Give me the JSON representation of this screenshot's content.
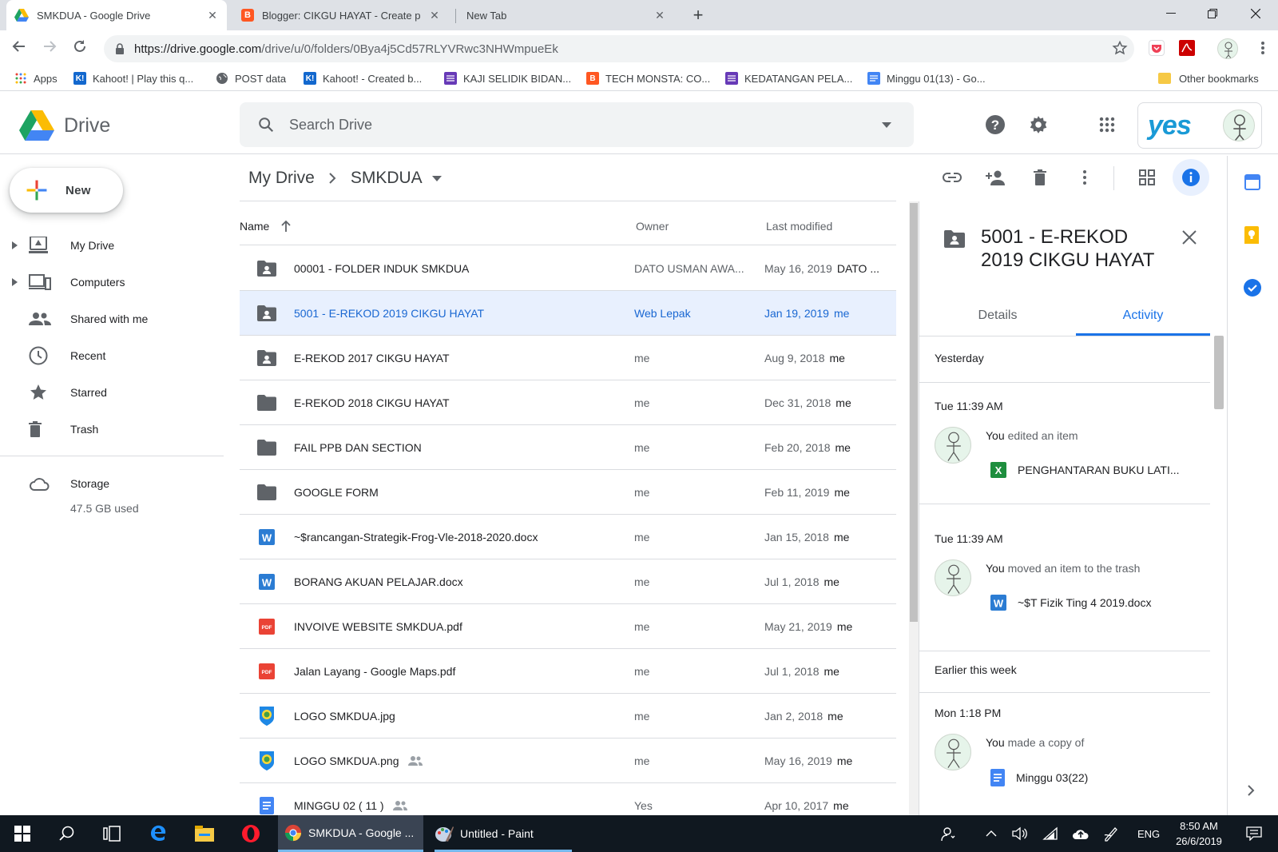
{
  "browser": {
    "tabs": [
      {
        "title": "SMKDUA - Google Drive",
        "active": true,
        "icon": "drive-icon"
      },
      {
        "title": "Blogger: CIKGU HAYAT - Create p",
        "active": false,
        "icon": "blogger-icon"
      },
      {
        "title": "New Tab",
        "active": false,
        "icon": ""
      }
    ],
    "url_host": "https://drive.google.com",
    "url_path": "/drive/u/0/folders/0Bya4j5Cd57RLYVRwc3NHWmpueEk",
    "bookmarks": [
      {
        "label": "Apps",
        "icon": "apps-grid-icon",
        "color": "#ea4335"
      },
      {
        "label": "Kahoot! | Play this q...",
        "icon": "kahoot-icon",
        "color": "#46178f"
      },
      {
        "label": "POST data",
        "icon": "globe-icon",
        "color": "#5f6368"
      },
      {
        "label": "Kahoot! - Created b...",
        "icon": "kahoot-icon",
        "color": "#46178f"
      },
      {
        "label": "KAJI SELIDIK BIDAN...",
        "icon": "forms-icon",
        "color": "#673ab7"
      },
      {
        "label": "TECH MONSTA: CO...",
        "icon": "blogger-icon",
        "color": "#ff5722"
      },
      {
        "label": "KEDATANGAN PELA...",
        "icon": "forms-icon",
        "color": "#673ab7"
      },
      {
        "label": "Minggu 01(13) - Go...",
        "icon": "docs-icon",
        "color": "#4285f4"
      }
    ],
    "other_bookmarks": "Other bookmarks"
  },
  "drive": {
    "logo_text": "Drive",
    "search_placeholder": "Search Drive",
    "account_badge": "yes",
    "new_label": "New",
    "nav": [
      {
        "label": "My Drive",
        "icon": "my-drive-icon",
        "expandable": true
      },
      {
        "label": "Computers",
        "icon": "computers-icon",
        "expandable": true
      },
      {
        "label": "Shared with me",
        "icon": "shared-icon",
        "expandable": false
      },
      {
        "label": "Recent",
        "icon": "clock-icon",
        "expandable": false
      },
      {
        "label": "Starred",
        "icon": "star-icon",
        "expandable": false
      },
      {
        "label": "Trash",
        "icon": "trash-icon",
        "expandable": false
      }
    ],
    "storage_label": "Storage",
    "storage_used": "47.5 GB used",
    "breadcrumb": {
      "root": "My Drive",
      "current": "SMKDUA"
    },
    "columns": {
      "name": "Name",
      "owner": "Owner",
      "modified": "Last modified"
    },
    "files": [
      {
        "name": "00001 - FOLDER INDUK SMKDUA",
        "type": "shared-folder",
        "owner": "DATO USMAN AWA...",
        "modified": "May 16, 2019",
        "by": "DATO ...",
        "shared": false,
        "selected": false
      },
      {
        "name": "5001 - E-REKOD 2019 CIKGU HAYAT",
        "type": "shared-folder",
        "owner": "Web Lepak",
        "modified": "Jan 19, 2019",
        "by": "me",
        "shared": false,
        "selected": true
      },
      {
        "name": "E-REKOD 2017 CIKGU HAYAT",
        "type": "shared-folder",
        "owner": "me",
        "modified": "Aug 9, 2018",
        "by": "me",
        "shared": false,
        "selected": false
      },
      {
        "name": "E-REKOD 2018 CIKGU HAYAT",
        "type": "folder",
        "owner": "me",
        "modified": "Dec 31, 2018",
        "by": "me",
        "shared": false,
        "selected": false
      },
      {
        "name": "FAIL PPB DAN SECTION",
        "type": "folder",
        "owner": "me",
        "modified": "Feb 20, 2018",
        "by": "me",
        "shared": false,
        "selected": false
      },
      {
        "name": "GOOGLE FORM",
        "type": "folder",
        "owner": "me",
        "modified": "Feb 11, 2019",
        "by": "me",
        "shared": false,
        "selected": false
      },
      {
        "name": "~$rancangan-Strategik-Frog-Vle-2018-2020.docx",
        "type": "word",
        "owner": "me",
        "modified": "Jan 15, 2018",
        "by": "me",
        "shared": false,
        "selected": false
      },
      {
        "name": "BORANG AKUAN PELAJAR.docx",
        "type": "word",
        "owner": "me",
        "modified": "Jul 1, 2018",
        "by": "me",
        "shared": false,
        "selected": false
      },
      {
        "name": "INVOIVE WEBSITE SMKDUA.pdf",
        "type": "pdf",
        "owner": "me",
        "modified": "May 21, 2019",
        "by": "me",
        "shared": false,
        "selected": false
      },
      {
        "name": "Jalan Layang - Google Maps.pdf",
        "type": "pdf",
        "owner": "me",
        "modified": "Jul 1, 2018",
        "by": "me",
        "shared": false,
        "selected": false
      },
      {
        "name": "LOGO SMKDUA.jpg",
        "type": "image",
        "owner": "me",
        "modified": "Jan 2, 2018",
        "by": "me",
        "shared": false,
        "selected": false
      },
      {
        "name": "LOGO SMKDUA.png",
        "type": "image",
        "owner": "me",
        "modified": "May 16, 2019",
        "by": "me",
        "shared": true,
        "selected": false
      },
      {
        "name": "MINGGU 02 ( 11 )",
        "type": "doc",
        "owner": "Yes",
        "modified": "Apr 10, 2017",
        "by": "me",
        "shared": true,
        "selected": false
      }
    ],
    "details": {
      "title_line1": "5001 - E-REKOD",
      "title_line2": "2019 CIKGU HAYAT",
      "tab_details": "Details",
      "tab_activity": "Activity",
      "groups": [
        {
          "heading": "Yesterday",
          "items": [
            {
              "time": "Tue 11:39 AM",
              "actor": "You",
              "action": "edited an item",
              "file": "PENGHANTARAN BUKU LATI...",
              "file_icon": "sheets-icon"
            },
            {
              "time": "Tue 11:39 AM",
              "actor": "You",
              "action": "moved an item to the trash",
              "file": "~$T Fizik Ting 4 2019.docx",
              "file_icon": "word-icon"
            }
          ]
        },
        {
          "heading": "Earlier this week",
          "items": [
            {
              "time": "Mon 1:18 PM",
              "actor": "You",
              "action": "made a copy of",
              "file": "Minggu 03(22)",
              "file_icon": "docs-icon"
            }
          ]
        }
      ]
    }
  },
  "taskbar": {
    "apps": [
      {
        "label": "SMKDUA - Google ...",
        "icon": "chrome-icon",
        "active": true
      },
      {
        "label": "Untitled - Paint",
        "icon": "paint-icon",
        "active": false
      }
    ],
    "lang": "ENG",
    "time": "8:50 AM",
    "date": "26/6/2019"
  },
  "colors": {
    "accent": "#1a73e8",
    "selected_row": "#e8f0fe",
    "taskbar": "#101820"
  }
}
